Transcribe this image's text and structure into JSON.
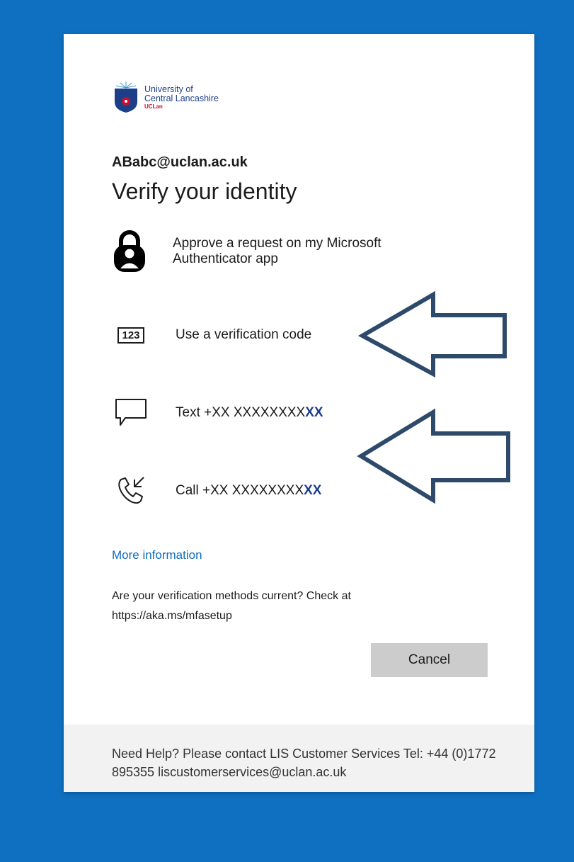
{
  "logo": {
    "line1": "University of",
    "line2": "Central Lancashire",
    "line3": "UCLan"
  },
  "account": {
    "email": "ABabc@uclan.ac.uk"
  },
  "page": {
    "title": "Verify your identity"
  },
  "options": [
    {
      "icon": "authenticator-lock-icon",
      "label": "Approve a request on my Microsoft Authenticator app"
    },
    {
      "icon": "numeric-code-icon",
      "icon_text": "123",
      "label": "Use a verification code"
    },
    {
      "icon": "sms-chat-icon",
      "label": "Text +XX XXXXXXXX",
      "suffix": "XX"
    },
    {
      "icon": "phone-call-icon",
      "label": "Call +XX XXXXXXXX",
      "suffix": "XX"
    }
  ],
  "links": {
    "more_info": "More information"
  },
  "note": "Are your verification methods current? Check at https://aka.ms/mfasetup",
  "buttons": {
    "cancel": "Cancel"
  },
  "footer": {
    "help": "Need Help? Please contact LIS Customer Services Tel: +44 (0)1772 895355 liscustomerservices@uclan.ac.uk"
  },
  "colors": {
    "background": "#0f70c2",
    "link": "#0f6cbd",
    "arrow_stroke": "#2e4a6b",
    "button": "#cccccc"
  }
}
